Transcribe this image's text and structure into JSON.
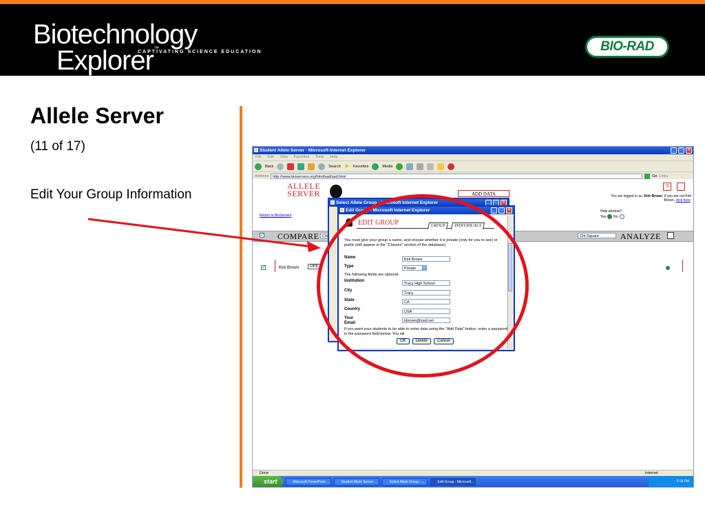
{
  "header": {
    "logo_line1": "Biotechnology",
    "logo_line2": "Explorer",
    "logo_tm": "™",
    "tagline": "CAPTIVATING SCIENCE EDUCATION",
    "brand": "BIO-RAD",
    "accent_color": "#f07c1e"
  },
  "slide": {
    "title": "Allele Server",
    "subtitle": "(11 of 17)",
    "description": "Edit Your Group Information"
  },
  "browser": {
    "title": "Student Allele Server - Microsoft Internet Explorer",
    "menu": [
      "File",
      "Edit",
      "View",
      "Favorites",
      "Tools",
      "Help"
    ],
    "toolbar": {
      "back": "Back",
      "search": "Search",
      "favorites": "Favorites",
      "media": "Media"
    },
    "address_label": "Address",
    "address": "http://www.bioservers.org/html/sad/sad.html",
    "go": "Go",
    "links": "Links",
    "status": "Done",
    "zone": "Internet"
  },
  "page": {
    "logo_line1": "ALLELE",
    "logo_line2": "SERVER",
    "return_link": "Return to BioServers",
    "add_data_button": "ADD DATA",
    "logged_in_text": "You are logged in as:",
    "logged_in_user": "Kirk Brown",
    "not_user_text": "If you are not Kirk Brown,",
    "click_here": "click here",
    "help_window_label": "Help window?",
    "help_yes": "Yes",
    "help_no": "No",
    "compare_label": "COMPARE",
    "compare_select": "Chi",
    "analyze_select": "Chi-Square",
    "analyze_label": "ANALYZE",
    "group_row_name": "Kirk Brown",
    "group_row_button": "OPE"
  },
  "select_dialog": {
    "title": "Select Allele Group - Microsoft Internet Explorer"
  },
  "edit_dialog": {
    "title": "Edit Group - Microsoft Internet Explorer",
    "heading": "EDIT GROUP",
    "tab_group": "GROUP",
    "tab_individuals": "INDIVIDUALS",
    "intro": "You must give your group a name, and choose whether it is private (only for you to see) or public (will appear in the \"Classes\" section of the database):",
    "name_label": "Name",
    "name_value": "Kirk Brown",
    "type_label": "Type",
    "type_value": "Private",
    "optional_text": "The following fields are optional:",
    "institution_label": "Institution",
    "institution_value": "Tracy High School",
    "city_label": "City",
    "city_value": "Tracy",
    "state_label": "State",
    "state_value": "CA",
    "country_label": "Country",
    "country_value": "USA",
    "email_label_1": "Your",
    "email_label_2": "Email",
    "email_value": "kbrown@tusd.net",
    "password_text": "If you want your students to be able to enter data using the \"Add Data\" button, enter a password in the password field below. You wil",
    "ok": "OK",
    "delete": "Delete",
    "cancel": "Cancel"
  },
  "taskbar": {
    "start": "start",
    "items": [
      "Microsoft PowerPoint ...",
      "Student Allele Server ...",
      "Select Allele Group - ...",
      "Edit Group - Microsoft..."
    ],
    "clock": "2:18 PM"
  },
  "annotation_color": "#e0141e"
}
